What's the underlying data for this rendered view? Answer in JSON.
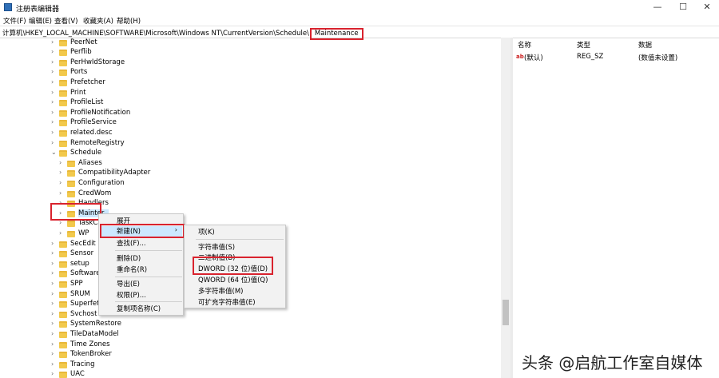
{
  "window": {
    "title": "注册表编辑器",
    "min": "—",
    "max": "☐",
    "close": "✕"
  },
  "menu": [
    "文件(F)",
    "编辑(E)",
    "查看(V)",
    "收藏夹(A)",
    "帮助(H)"
  ],
  "address": {
    "prefix": "计算机\\HKEY_LOCAL_MACHINE\\SOFTWARE\\Microsoft\\Windows NT\\CurrentVersion\\Schedule\\",
    "current": "Maintenance"
  },
  "tree": [
    {
      "label": "PeerNet",
      "depth": 0
    },
    {
      "label": "Perflib",
      "depth": 0
    },
    {
      "label": "PerHwIdStorage",
      "depth": 0
    },
    {
      "label": "Ports",
      "depth": 0
    },
    {
      "label": "Prefetcher",
      "depth": 0
    },
    {
      "label": "Print",
      "depth": 0
    },
    {
      "label": "ProfileList",
      "depth": 0
    },
    {
      "label": "ProfileNotification",
      "depth": 0
    },
    {
      "label": "ProfileService",
      "depth": 0
    },
    {
      "label": "related.desc",
      "depth": 0
    },
    {
      "label": "RemoteRegistry",
      "depth": 0
    },
    {
      "label": "Schedule",
      "depth": 0,
      "expanded": true
    },
    {
      "label": "Aliases",
      "depth": 1
    },
    {
      "label": "CompatibilityAdapter",
      "depth": 1
    },
    {
      "label": "Configuration",
      "depth": 1
    },
    {
      "label": "CredWom",
      "depth": 1
    },
    {
      "label": "Handlers",
      "depth": 1
    },
    {
      "label": "Mainter",
      "depth": 1,
      "selected": true
    },
    {
      "label": "TaskCa",
      "depth": 1
    },
    {
      "label": "WP",
      "depth": 1
    },
    {
      "label": "SecEdit",
      "depth": 0
    },
    {
      "label": "Sensor",
      "depth": 0
    },
    {
      "label": "setup",
      "depth": 0
    },
    {
      "label": "SoftwareP",
      "depth": 0
    },
    {
      "label": "SPP",
      "depth": 0
    },
    {
      "label": "SRUM",
      "depth": 0
    },
    {
      "label": "Superfetch",
      "depth": 0
    },
    {
      "label": "Svchost",
      "depth": 0
    },
    {
      "label": "SystemRestore",
      "depth": 0
    },
    {
      "label": "TileDataModel",
      "depth": 0
    },
    {
      "label": "Time Zones",
      "depth": 0
    },
    {
      "label": "TokenBroker",
      "depth": 0
    },
    {
      "label": "Tracing",
      "depth": 0
    },
    {
      "label": "UAC",
      "depth": 0
    }
  ],
  "list": {
    "headers": {
      "name": "名称",
      "type": "类型",
      "data": "数据"
    },
    "rows": [
      {
        "name": "(默认)",
        "type": "REG_SZ",
        "data": "(数值未设置)"
      }
    ]
  },
  "context_menu": {
    "items": [
      "展开",
      "新建(N)",
      "查找(F)...",
      "删除(D)",
      "重命名(R)",
      "导出(E)",
      "权限(P)...",
      "复制项名称(C)"
    ],
    "arrow": "›"
  },
  "submenu": {
    "items": [
      "项(K)",
      "字符串值(S)",
      "二进制值(B)",
      "DWORD (32 位)值(D)",
      "QWORD (64 位)值(Q)",
      "多字符串值(M)",
      "可扩充字符串值(E)"
    ]
  },
  "watermark": "头条 @启航工作室自媒体",
  "colors": {
    "highlight": "#d9232e",
    "selection": "#cce8ff",
    "folder": "#f2c94c"
  }
}
